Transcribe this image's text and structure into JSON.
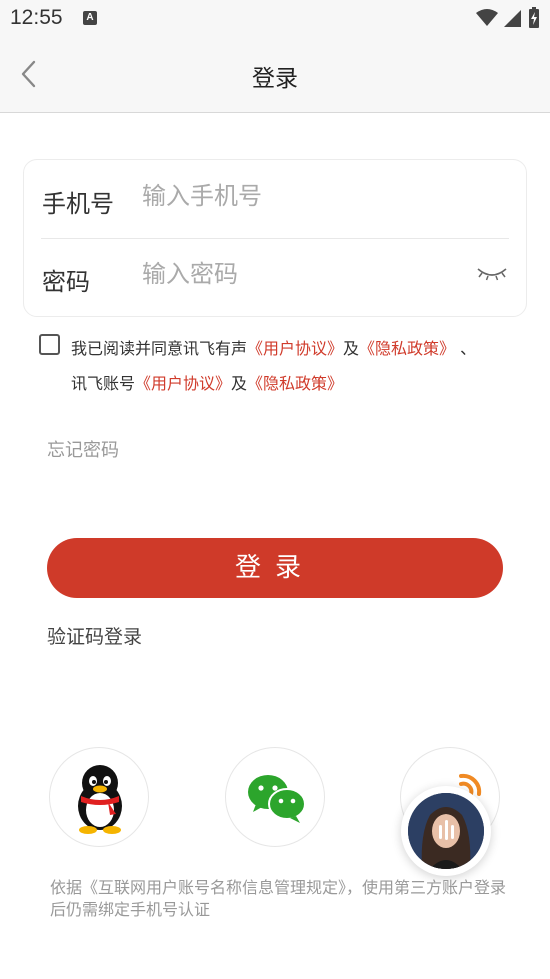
{
  "status_bar": {
    "time": "12:55",
    "notification_icon": "A"
  },
  "header": {
    "title": "登录",
    "back_icon": "chevron-left-icon"
  },
  "form": {
    "phone_label": "手机号",
    "phone_placeholder": "输入手机号",
    "password_label": "密码",
    "password_placeholder": "输入密码",
    "password_toggle_icon": "eye-closed-icon"
  },
  "agreement": {
    "prefix": "我已阅读并同意讯飞有声",
    "link1": "《用户协议》",
    "and1": "及",
    "link2": "《隐私政策》",
    "separator": " 、",
    "middle": "讯飞账号",
    "link3": "《用户协议》",
    "and2": "及",
    "link4": "《隐私政策》"
  },
  "forgot_password": "忘记密码",
  "login_button": "登录",
  "sms_login": "验证码登录",
  "social": {
    "qq_icon": "qq-penguin-icon",
    "wechat_icon": "wechat-icon",
    "weibo_icon": "weibo-icon"
  },
  "footer_note": "依据《互联网用户账号名称信息管理规定》，使用第三方账户登录后仍需绑定手机号认证",
  "colors": {
    "accent": "#cf3a29",
    "link": "#d03b2b"
  }
}
